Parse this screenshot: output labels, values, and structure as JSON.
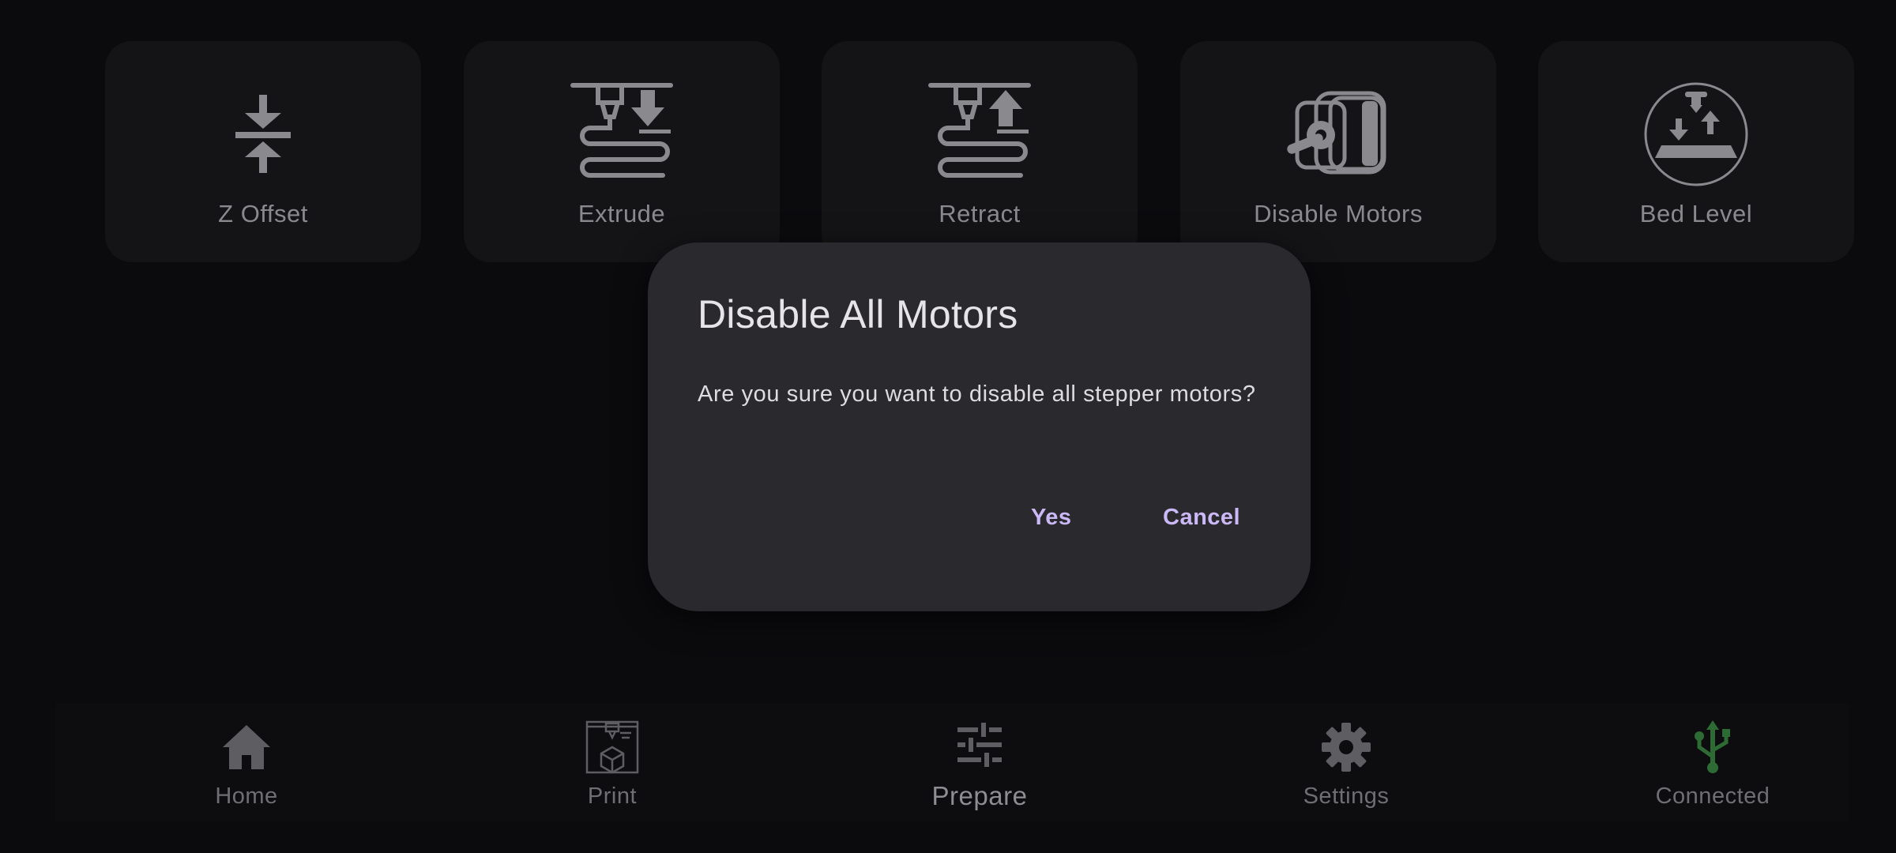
{
  "tiles": [
    {
      "label": "Z Offset",
      "icon": "z-offset-icon"
    },
    {
      "label": "Extrude",
      "icon": "extrude-icon"
    },
    {
      "label": "Retract",
      "icon": "retract-icon"
    },
    {
      "label": "Disable Motors",
      "icon": "stepper-motor-icon"
    },
    {
      "label": "Bed Level",
      "icon": "bed-level-icon"
    }
  ],
  "dialog": {
    "title": "Disable All Motors",
    "message": "Are you sure you want to disable all stepper motors?",
    "yes_label": "Yes",
    "cancel_label": "Cancel"
  },
  "nav": [
    {
      "label": "Home",
      "icon": "home-icon"
    },
    {
      "label": "Print",
      "icon": "printer-icon"
    },
    {
      "label": "Prepare",
      "icon": "sliders-icon",
      "active": true
    },
    {
      "label": "Settings",
      "icon": "gear-icon"
    },
    {
      "label": "Connected",
      "icon": "usb-icon"
    }
  ],
  "colors": {
    "background": "#0b0b0e",
    "tile": "#141417",
    "dialog": "#2a292e",
    "accent": "#cbb8f6",
    "connected": "#2e6b34"
  }
}
